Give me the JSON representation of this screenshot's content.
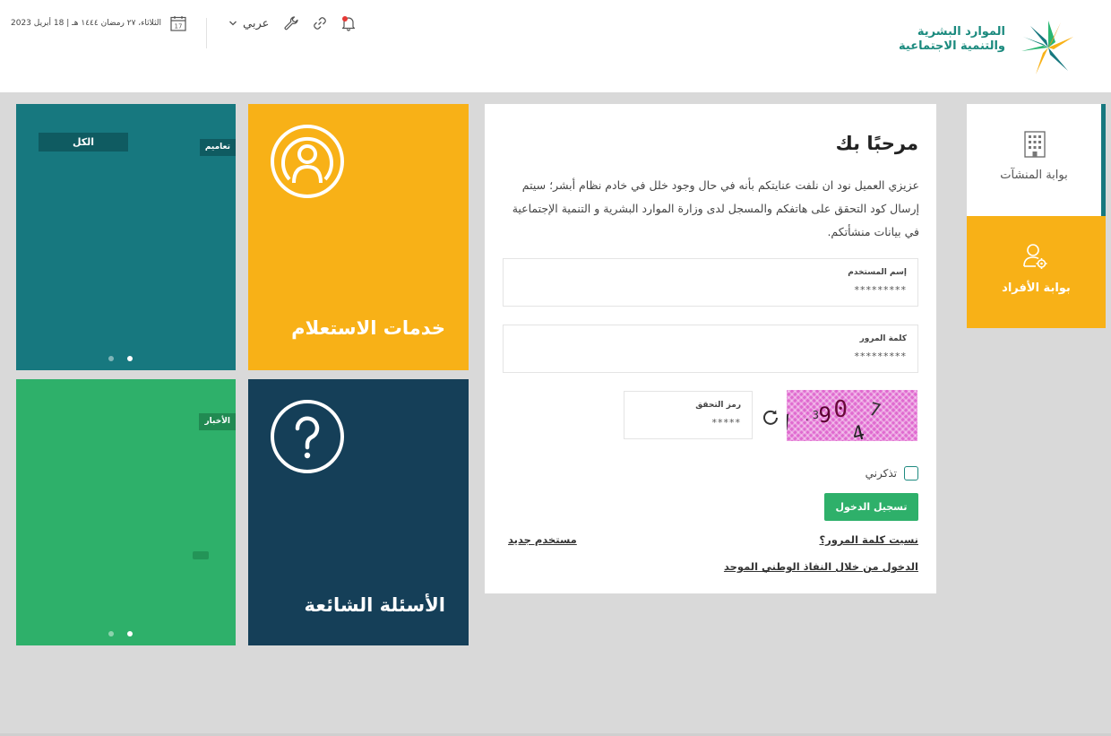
{
  "header": {
    "logo_line1": "الموارد البشرية",
    "logo_line2": "والتنمية الاجتماعية",
    "date": "الثلاثاء، ٢٧ رمضان ١٤٤٤ هـ | 18 أبريل 2023",
    "calendar_day": "17",
    "language": "عربي",
    "icons": [
      "calendar-icon",
      "chevron-down-icon",
      "wrench-icon",
      "link-icon",
      "bell-icon"
    ],
    "notification_dot_color": "#e53935"
  },
  "tiles": {
    "news": {
      "all_label": "الكل",
      "tag": "تعاميم",
      "dots": 2
    },
    "inquiry": {
      "title": "خدمات الاستعلام",
      "icon": "user-broadcast-icon",
      "color": "#f8b117"
    },
    "announcements": {
      "tag": "الأخبار",
      "dots": 2
    },
    "faq": {
      "title": "الأسئلة الشائعة",
      "icon": "question-icon",
      "color": "#153f58"
    }
  },
  "login": {
    "welcome": "مرحبًا بك",
    "intro": "عزيزي العميل نود ان نلفت عنايتكم بأنه في حال وجود خلل في خادم نظام أبشر؛ سيتم إرسال كود التحقق على هاتفكم والمسجل لدى وزارة الموارد البشرية و التنمية الإجتماعية في بيانات منشأتكم.",
    "username_label": "إسم المستخدم",
    "username_value": "*********",
    "password_label": "كلمة المرور",
    "password_value": "*********",
    "captcha_label": "رمز التحقق",
    "captcha_value": "*****",
    "remember_label": "تذكرني",
    "login_button": "تسجيل الدخول",
    "forgot_password": "نسيت كلمة المرور؟",
    "new_user": "مستخدم جديد",
    "nafath_login": "الدخول من خلال النفاذ الوطني الموحد"
  },
  "portals": {
    "establishments": {
      "label": "بوابة المنشآت",
      "icon": "building-icon"
    },
    "individuals": {
      "label": "بوابة الأفراد",
      "icon": "user-gear-icon"
    }
  }
}
